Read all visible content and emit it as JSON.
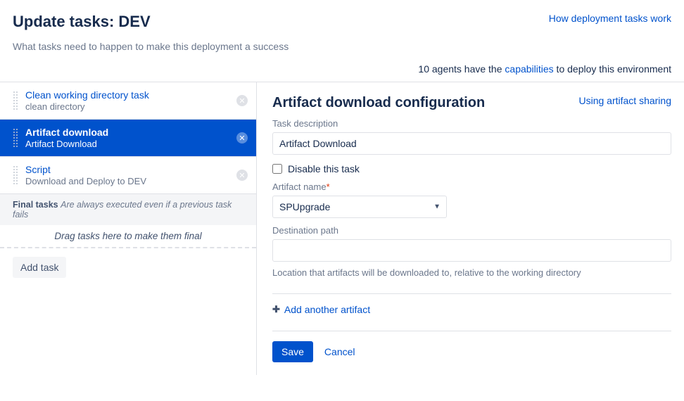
{
  "header": {
    "title": "Update tasks: DEV",
    "help_link": "How deployment tasks work",
    "subtitle": "What tasks need to happen to make this deployment a success"
  },
  "agents": {
    "prefix": "10 agents have the ",
    "link": "capabilities",
    "suffix": " to deploy this environment"
  },
  "tasks": [
    {
      "title": "Clean working directory task",
      "desc": "clean directory",
      "selected": false
    },
    {
      "title": "Artifact download",
      "desc": "Artifact Download",
      "selected": true
    },
    {
      "title": "Script",
      "desc": "Download and Deploy to DEV",
      "selected": false
    }
  ],
  "final_tasks": {
    "label": "Final tasks",
    "note": "Are always executed even if a previous task fails",
    "drag_hint": "Drag tasks here to make them final"
  },
  "add_task_label": "Add task",
  "config": {
    "title": "Artifact download configuration",
    "help_link": "Using artifact sharing",
    "desc_label": "Task description",
    "desc_value": "Artifact Download",
    "disable_label": "Disable this task",
    "disable_checked": false,
    "artifact_label": "Artifact name",
    "artifact_value": "SPUpgrade",
    "dest_label": "Destination path",
    "dest_value": "",
    "dest_hint": "Location that artifacts will be downloaded to, relative to the working directory",
    "add_artifact": "Add another artifact",
    "save": "Save",
    "cancel": "Cancel"
  }
}
